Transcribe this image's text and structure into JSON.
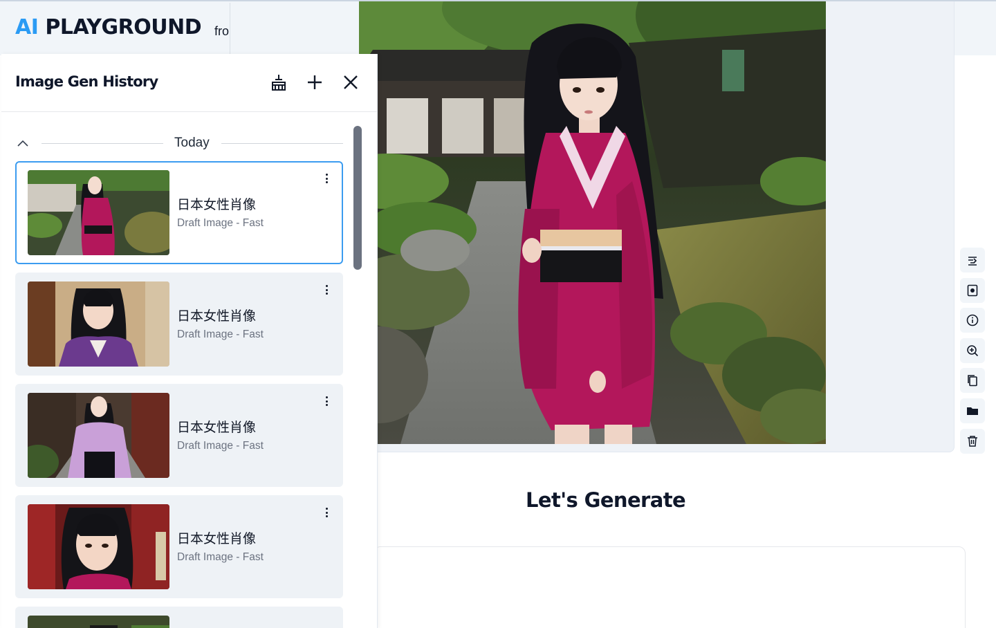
{
  "app": {
    "logo_ai": "AI",
    "logo_name": "PLAYGROUND",
    "logo_suffix": "fro"
  },
  "history": {
    "title": "Image Gen History",
    "header_icons": [
      "broom-icon",
      "plus-icon",
      "close-icon"
    ],
    "groups": [
      {
        "label": "Today",
        "items": [
          {
            "title": "日本女性肖像",
            "subtitle": "Draft Image - Fast",
            "selected": true
          },
          {
            "title": "日本女性肖像",
            "subtitle": "Draft Image - Fast",
            "selected": false
          },
          {
            "title": "日本女性肖像",
            "subtitle": "Draft Image - Fast",
            "selected": false
          },
          {
            "title": "日本女性肖像",
            "subtitle": "Draft Image - Fast",
            "selected": false
          }
        ]
      }
    ]
  },
  "main": {
    "heading": "Let's Generate"
  },
  "image_tools": [
    "upscale-icon",
    "image-reference-icon",
    "info-icon",
    "zoom-in-icon",
    "copy-icon",
    "folder-icon",
    "trash-icon"
  ],
  "colors": {
    "accent": "#2b9bf4",
    "selected_border": "#3b9cf0",
    "kimono_magenta": "#b3175b",
    "kimono_purple": "#6b3a8e",
    "kimono_lilac": "#c9a0d8"
  }
}
